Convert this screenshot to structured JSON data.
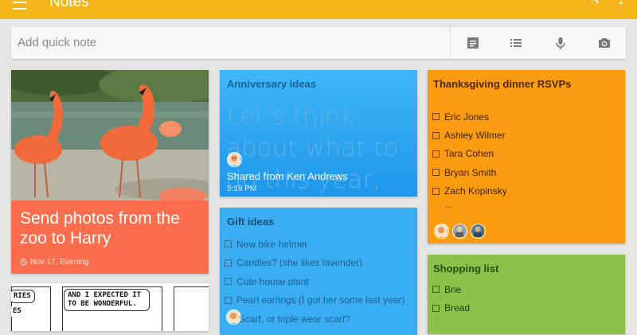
{
  "app": {
    "title": "Notes"
  },
  "quick_note": {
    "placeholder": "Add quick note"
  },
  "icons": {
    "menu": "menu-icon",
    "search": "search-icon",
    "more": "more-vert-icon",
    "note": "note-icon",
    "list": "list-icon",
    "mic": "mic-icon",
    "camera": "camera-icon",
    "reminder": "clock-icon"
  },
  "colors": {
    "appbar": "#f4b61a",
    "coral": "#fb6d4c",
    "blue": "#3aaef2",
    "orange": "#fb9b12",
    "green": "#8bc34a"
  },
  "notes": {
    "flamingo": {
      "text": "Send photos from the zoo to Harry",
      "reminder": "Nov 17, Evening"
    },
    "comic": {
      "bubble_left": "RIES",
      "bubble_left_2": "ES",
      "bubble_right": "AND I EXPECTED IT TO BE WONDERFUL."
    },
    "anniversary": {
      "title": "Anniversary ideas",
      "body": "Let’s think about what to do this year, love you!",
      "shared": "Shared from Ken Andrews",
      "time": "5:19 PM"
    },
    "gift": {
      "title": "Gift ideas",
      "items": [
        "New bike helmet",
        "Candles? (she likes lavender)",
        "Cute house plant",
        "Pearl earrings (I got her some last year)",
        "Scarf, or triple wear scarf?"
      ]
    },
    "thanksgiving": {
      "title": "Thanksgiving dinner RSVPs",
      "items": [
        "Eric Jones",
        "Ashley Wilmer",
        "Tara Cohen",
        "Bryan Smith",
        "Zach Kopinsky"
      ],
      "more": "..."
    },
    "shopping": {
      "title": "Shopping list",
      "items": [
        "Brie",
        "Bread"
      ]
    }
  }
}
